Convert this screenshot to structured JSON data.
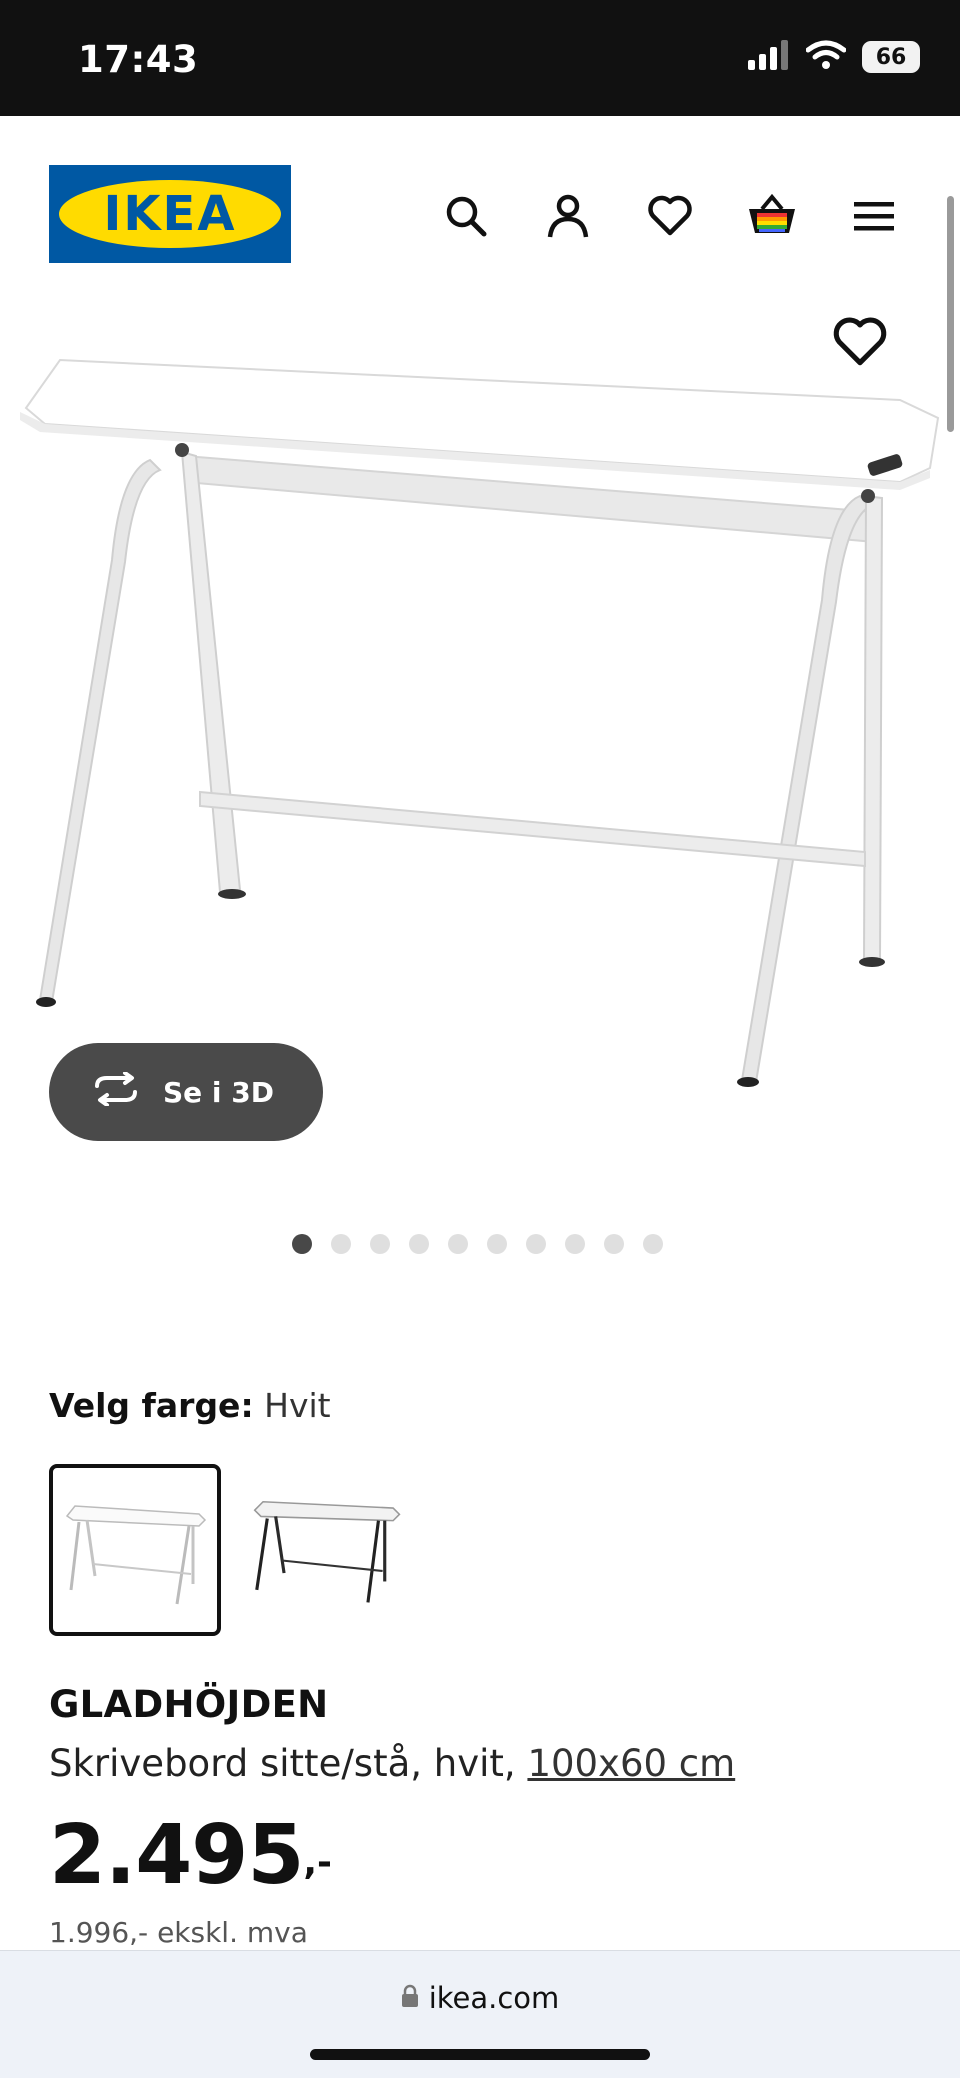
{
  "status_bar": {
    "time": "17:43",
    "battery": "66"
  },
  "header": {
    "logo_text": "IKEA",
    "icons": [
      "search-icon",
      "account-icon",
      "favourites-icon",
      "cart-icon",
      "menu-icon"
    ]
  },
  "gallery": {
    "view_3d_label": "Se i 3D",
    "image_count": 10,
    "active_index": 0
  },
  "color_select": {
    "label": "Velg farge:",
    "value": "Hvit",
    "options": [
      "white",
      "black"
    ],
    "selected_index": 0
  },
  "product": {
    "name": "GLADHÖJDEN",
    "description": "Skrivebord sitte/stå, hvit, ",
    "size_link": "100x60 cm",
    "price_main": "2.495",
    "price_suffix": ",-",
    "price_ex_vat": "1.996,- ekskl. mva"
  },
  "browser": {
    "url": "ikea.com"
  },
  "colors": {
    "brand_blue": "#0058a3",
    "brand_yellow": "#ffdb00",
    "button_dark": "#4a4a4a"
  }
}
